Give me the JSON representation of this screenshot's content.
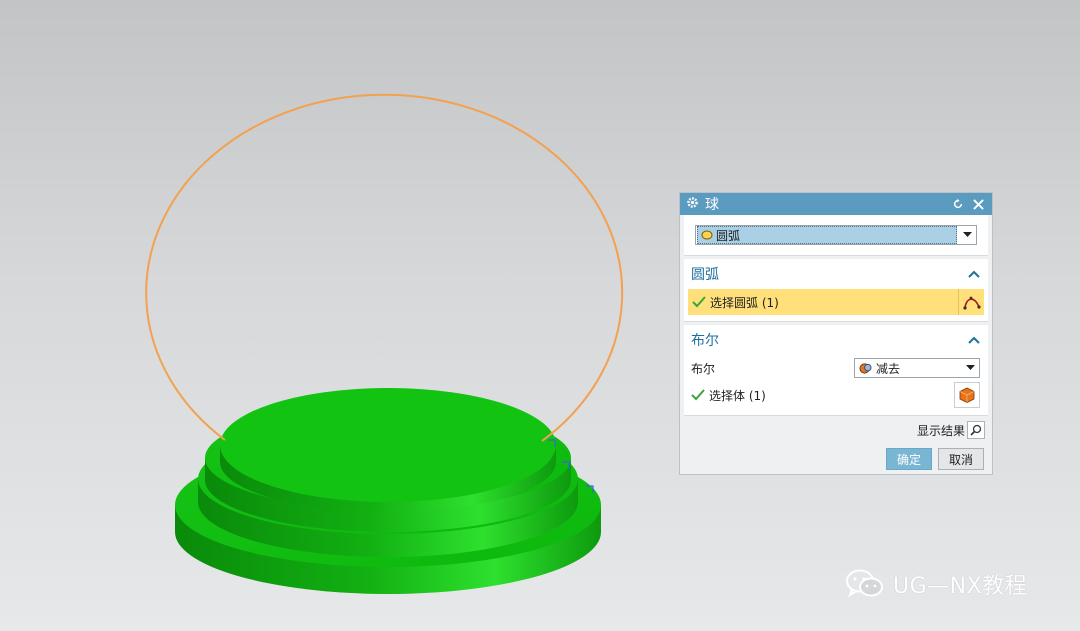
{
  "dialog": {
    "title": "球",
    "type_select": {
      "value": "圆弧"
    },
    "arc_section": {
      "header": "圆弧",
      "select_label": "选择圆弧 (1)"
    },
    "boolean_section": {
      "header": "布尔",
      "boolean_label": "布尔",
      "boolean_value": "减去",
      "select_body_label": "选择体 (1)"
    },
    "show_result_label": "显示结果",
    "ok_label": "确定",
    "cancel_label": "取消"
  },
  "watermark": {
    "text": "UG—NX教程"
  },
  "colors": {
    "title_bar": "#5b9bbf",
    "section_header": "#1f6f9c",
    "selection_highlight": "#ffe07a",
    "arc": "#f3a14f",
    "body_green": "#14c414"
  },
  "icons": [
    "gear-icon",
    "reset-icon",
    "close-icon",
    "arc-type-icon",
    "chevron-down-icon",
    "collapse-up-icon",
    "check-icon",
    "arc-select-icon",
    "subtract-icon",
    "body-select-icon",
    "magnifier-icon",
    "wechat-icon"
  ]
}
